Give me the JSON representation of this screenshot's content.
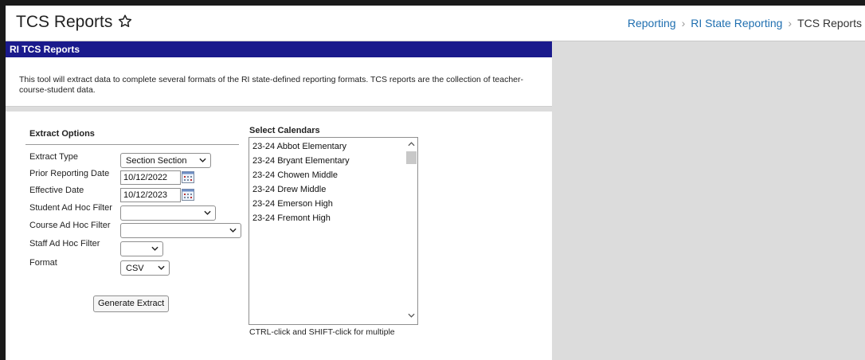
{
  "header": {
    "title": "TCS Reports",
    "breadcrumb": [
      "Reporting",
      "RI State Reporting",
      "TCS Reports"
    ]
  },
  "section": {
    "title": "RI TCS Reports",
    "description": "This tool will extract data to complete several formats of the RI state-defined reporting formats. TCS reports are the collection of teacher-course-student data."
  },
  "extract_options": {
    "title": "Extract Options",
    "extract_type": {
      "label": "Extract Type",
      "value": "Section Section"
    },
    "prior_reporting_date": {
      "label": "Prior Reporting Date",
      "value": "10/12/2022"
    },
    "effective_date": {
      "label": "Effective Date",
      "value": "10/12/2023"
    },
    "student_filter": {
      "label": "Student Ad Hoc Filter",
      "value": ""
    },
    "course_filter": {
      "label": "Course Ad Hoc Filter",
      "value": ""
    },
    "staff_filter": {
      "label": "Staff Ad Hoc Filter",
      "value": ""
    },
    "format": {
      "label": "Format",
      "value": "CSV"
    },
    "generate_button": "Generate Extract"
  },
  "calendars": {
    "title": "Select Calendars",
    "items": [
      "23-24 Abbot Elementary",
      "23-24 Bryant Elementary",
      "23-24 Chowen Middle",
      "23-24 Drew Middle",
      "23-24 Emerson High",
      "23-24 Fremont High"
    ],
    "hint": "CTRL-click and SHIFT-click for multiple"
  },
  "colors": {
    "section_header_bg": "#1a1a8c",
    "link": "#1f6fb0",
    "panel_bg": "#dcdcdc"
  },
  "icons": {
    "favorite": "star-outline-icon",
    "date_picker": "calendar-icon",
    "dropdown": "chevron-down-icon"
  }
}
